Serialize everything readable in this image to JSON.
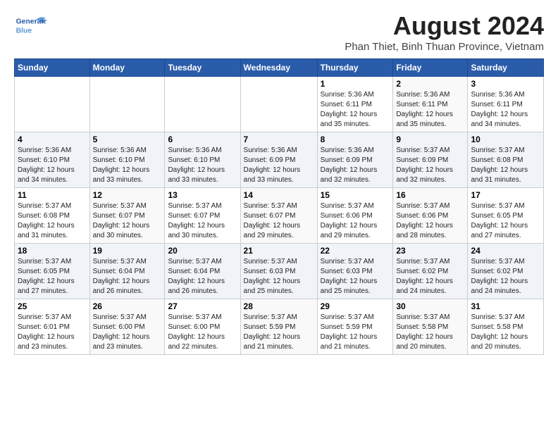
{
  "header": {
    "logo_text_general": "General",
    "logo_text_blue": "Blue",
    "title": "August 2024",
    "subtitle": "Phan Thiet, Binh Thuan Province, Vietnam"
  },
  "days_of_week": [
    "Sunday",
    "Monday",
    "Tuesday",
    "Wednesday",
    "Thursday",
    "Friday",
    "Saturday"
  ],
  "weeks": [
    [
      {
        "day": "",
        "info": ""
      },
      {
        "day": "",
        "info": ""
      },
      {
        "day": "",
        "info": ""
      },
      {
        "day": "",
        "info": ""
      },
      {
        "day": "1",
        "info": "Sunrise: 5:36 AM\nSunset: 6:11 PM\nDaylight: 12 hours\nand 35 minutes."
      },
      {
        "day": "2",
        "info": "Sunrise: 5:36 AM\nSunset: 6:11 PM\nDaylight: 12 hours\nand 35 minutes."
      },
      {
        "day": "3",
        "info": "Sunrise: 5:36 AM\nSunset: 6:11 PM\nDaylight: 12 hours\nand 34 minutes."
      }
    ],
    [
      {
        "day": "4",
        "info": "Sunrise: 5:36 AM\nSunset: 6:10 PM\nDaylight: 12 hours\nand 34 minutes."
      },
      {
        "day": "5",
        "info": "Sunrise: 5:36 AM\nSunset: 6:10 PM\nDaylight: 12 hours\nand 33 minutes."
      },
      {
        "day": "6",
        "info": "Sunrise: 5:36 AM\nSunset: 6:10 PM\nDaylight: 12 hours\nand 33 minutes."
      },
      {
        "day": "7",
        "info": "Sunrise: 5:36 AM\nSunset: 6:09 PM\nDaylight: 12 hours\nand 33 minutes."
      },
      {
        "day": "8",
        "info": "Sunrise: 5:36 AM\nSunset: 6:09 PM\nDaylight: 12 hours\nand 32 minutes."
      },
      {
        "day": "9",
        "info": "Sunrise: 5:37 AM\nSunset: 6:09 PM\nDaylight: 12 hours\nand 32 minutes."
      },
      {
        "day": "10",
        "info": "Sunrise: 5:37 AM\nSunset: 6:08 PM\nDaylight: 12 hours\nand 31 minutes."
      }
    ],
    [
      {
        "day": "11",
        "info": "Sunrise: 5:37 AM\nSunset: 6:08 PM\nDaylight: 12 hours\nand 31 minutes."
      },
      {
        "day": "12",
        "info": "Sunrise: 5:37 AM\nSunset: 6:07 PM\nDaylight: 12 hours\nand 30 minutes."
      },
      {
        "day": "13",
        "info": "Sunrise: 5:37 AM\nSunset: 6:07 PM\nDaylight: 12 hours\nand 30 minutes."
      },
      {
        "day": "14",
        "info": "Sunrise: 5:37 AM\nSunset: 6:07 PM\nDaylight: 12 hours\nand 29 minutes."
      },
      {
        "day": "15",
        "info": "Sunrise: 5:37 AM\nSunset: 6:06 PM\nDaylight: 12 hours\nand 29 minutes."
      },
      {
        "day": "16",
        "info": "Sunrise: 5:37 AM\nSunset: 6:06 PM\nDaylight: 12 hours\nand 28 minutes."
      },
      {
        "day": "17",
        "info": "Sunrise: 5:37 AM\nSunset: 6:05 PM\nDaylight: 12 hours\nand 27 minutes."
      }
    ],
    [
      {
        "day": "18",
        "info": "Sunrise: 5:37 AM\nSunset: 6:05 PM\nDaylight: 12 hours\nand 27 minutes."
      },
      {
        "day": "19",
        "info": "Sunrise: 5:37 AM\nSunset: 6:04 PM\nDaylight: 12 hours\nand 26 minutes."
      },
      {
        "day": "20",
        "info": "Sunrise: 5:37 AM\nSunset: 6:04 PM\nDaylight: 12 hours\nand 26 minutes."
      },
      {
        "day": "21",
        "info": "Sunrise: 5:37 AM\nSunset: 6:03 PM\nDaylight: 12 hours\nand 25 minutes."
      },
      {
        "day": "22",
        "info": "Sunrise: 5:37 AM\nSunset: 6:03 PM\nDaylight: 12 hours\nand 25 minutes."
      },
      {
        "day": "23",
        "info": "Sunrise: 5:37 AM\nSunset: 6:02 PM\nDaylight: 12 hours\nand 24 minutes."
      },
      {
        "day": "24",
        "info": "Sunrise: 5:37 AM\nSunset: 6:02 PM\nDaylight: 12 hours\nand 24 minutes."
      }
    ],
    [
      {
        "day": "25",
        "info": "Sunrise: 5:37 AM\nSunset: 6:01 PM\nDaylight: 12 hours\nand 23 minutes."
      },
      {
        "day": "26",
        "info": "Sunrise: 5:37 AM\nSunset: 6:00 PM\nDaylight: 12 hours\nand 23 minutes."
      },
      {
        "day": "27",
        "info": "Sunrise: 5:37 AM\nSunset: 6:00 PM\nDaylight: 12 hours\nand 22 minutes."
      },
      {
        "day": "28",
        "info": "Sunrise: 5:37 AM\nSunset: 5:59 PM\nDaylight: 12 hours\nand 21 minutes."
      },
      {
        "day": "29",
        "info": "Sunrise: 5:37 AM\nSunset: 5:59 PM\nDaylight: 12 hours\nand 21 minutes."
      },
      {
        "day": "30",
        "info": "Sunrise: 5:37 AM\nSunset: 5:58 PM\nDaylight: 12 hours\nand 20 minutes."
      },
      {
        "day": "31",
        "info": "Sunrise: 5:37 AM\nSunset: 5:58 PM\nDaylight: 12 hours\nand 20 minutes."
      }
    ]
  ]
}
